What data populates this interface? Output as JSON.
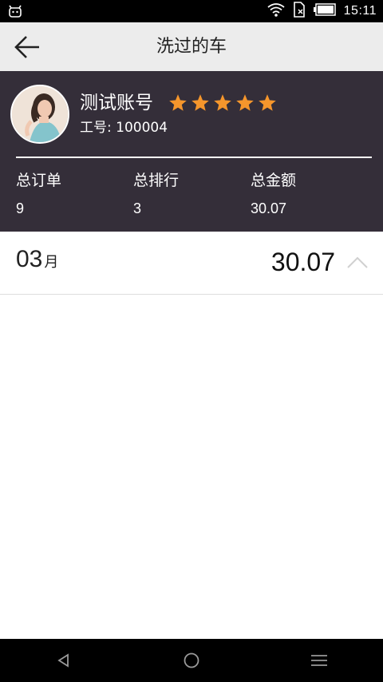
{
  "status_bar": {
    "time": "15:11",
    "icons": [
      "android-icon",
      "wifi-icon",
      "sim-icon",
      "battery-icon"
    ]
  },
  "app_bar": {
    "title": "洗过的车",
    "back_icon": "arrow-left-icon"
  },
  "profile": {
    "name": "测试账号",
    "rating": 5,
    "rating_max": 5,
    "employee_id": "工号: 100004",
    "star_color": "#f5962c",
    "background": "#342e39",
    "stats": [
      {
        "label": "总订单",
        "value": "9"
      },
      {
        "label": "总排行",
        "value": "3"
      },
      {
        "label": "总金额",
        "value": "30.07"
      }
    ]
  },
  "month_group": {
    "month": "03",
    "unit": "月",
    "amount": "30.07",
    "toggle_icon": "chevron-up-icon"
  },
  "nav_bar": {
    "icons": [
      "back-triangle-icon",
      "home-circle-icon",
      "menu-lines-icon"
    ]
  }
}
